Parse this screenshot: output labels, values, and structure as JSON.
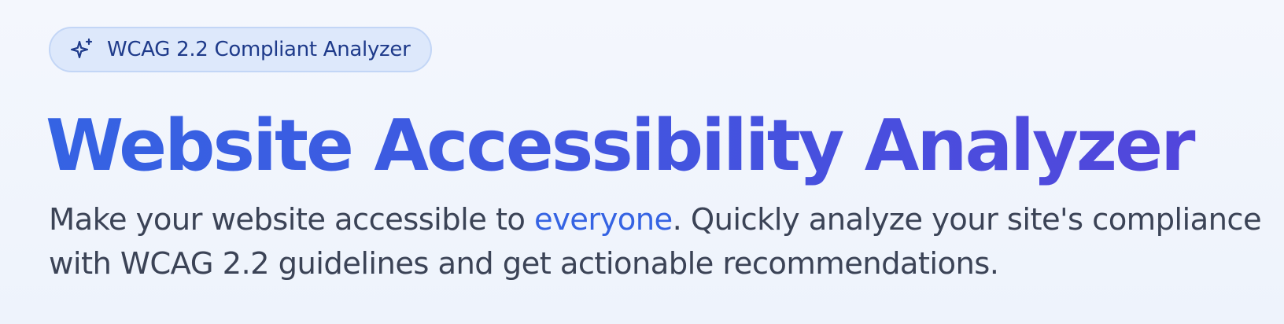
{
  "badge": {
    "icon": "sparkles-icon",
    "text": "WCAG 2.2 Compliant Analyzer"
  },
  "hero": {
    "title": "Website Accessibility Analyzer",
    "subtitle": {
      "line1_before": "Make your website accessible to ",
      "line1_highlight": "everyone",
      "line1_after": ". Quickly analyze your site's compliance",
      "line2": "with WCAG 2.2 guidelines and get actionable recommendations."
    }
  },
  "colors": {
    "background": "#f1f5fc",
    "badge_bg": "#dde8fb",
    "badge_text": "#1e3a8a",
    "title_gradient_start": "#3563e3",
    "title_gradient_end": "#5444db",
    "body_text": "#3b4356",
    "highlight": "#3563e3"
  }
}
